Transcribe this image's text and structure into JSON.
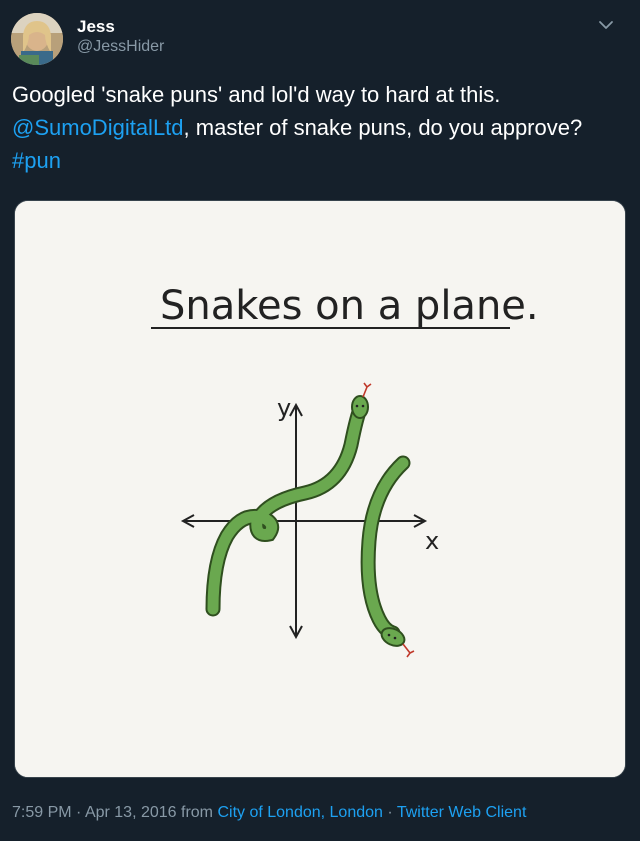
{
  "author": {
    "name": "Jess",
    "handle": "@JessHider",
    "avatar_icon": "user-avatar-photo"
  },
  "tweet": {
    "text_part1": "Googled 'snake puns' and lol'd way to hard at this.",
    "mention": "@SumoDigitalLtd",
    "text_part2": ", master of snake puns, do you approve? ",
    "hashtag": "#pun"
  },
  "media": {
    "caption": "Snakes on a plane.",
    "axis_y_label": "y",
    "axis_x_label": "x"
  },
  "footer": {
    "time": "7:59 PM",
    "sep1": " · ",
    "date": "Apr 13, 2016",
    "from": " from ",
    "location": "City of London, London",
    "sep2": " · ",
    "client": "Twitter Web Client"
  },
  "colors": {
    "background": "#15202b",
    "link": "#1da1f2",
    "secondary_text": "#8899a6",
    "snake_green": "#6aa84f"
  }
}
